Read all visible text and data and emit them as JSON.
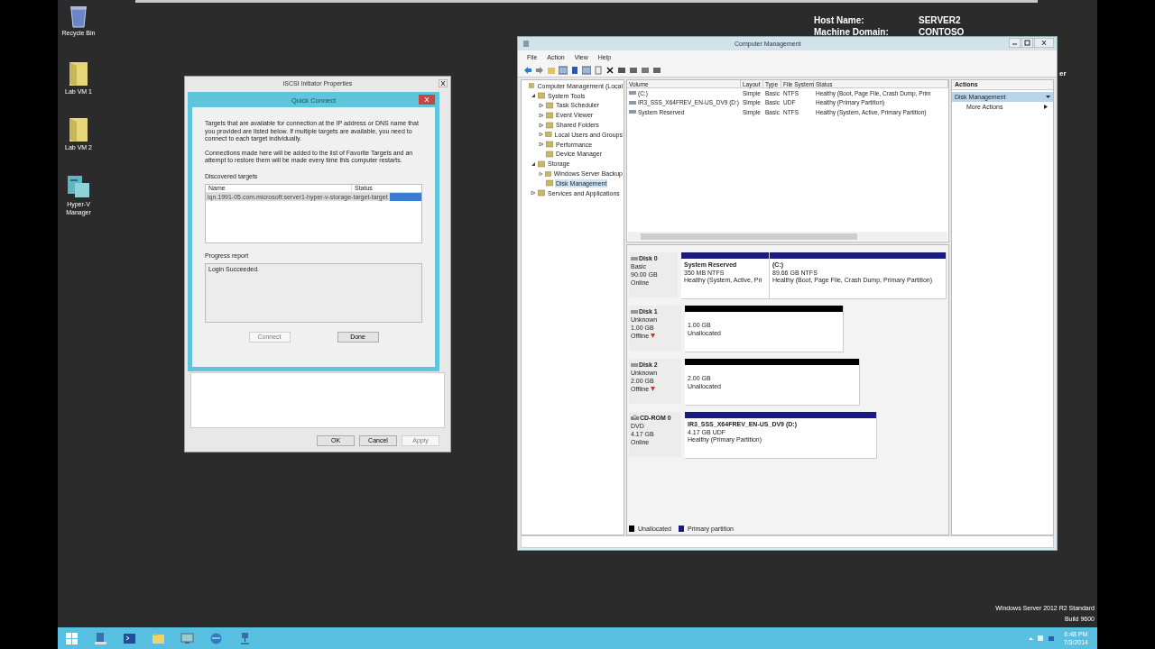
{
  "desktop_icons": [
    {
      "label": "Recycle Bin",
      "kind": "recycle"
    },
    {
      "label": "Lab VM 1",
      "kind": "folder"
    },
    {
      "label": "Lab VM 2",
      "kind": "folder"
    },
    {
      "label": "Hyper-V Manager",
      "kind": "hyperv"
    }
  ],
  "bginfo": [
    {
      "label": "Host Name:",
      "value": "SERVER2"
    },
    {
      "label": "Machine Domain:",
      "value": "CONTOSO"
    }
  ],
  "bginfo_fragment": "er",
  "os_edition": [
    "Windows Server 2012 R2 Standard",
    "Build 9600"
  ],
  "iscsi_window": {
    "title": "iSCSI Initiator Properties",
    "buttons": [
      {
        "label": "OK",
        "disabled": false
      },
      {
        "label": "Cancel",
        "disabled": false
      },
      {
        "label": "Apply",
        "disabled": true
      }
    ]
  },
  "quick_connect": {
    "title": "Quick Connect",
    "intro": "Targets that are available for connection at the IP address or DNS name that you provided are listed below.  If multiple targets are available, you need to connect to each target individually.",
    "note": "Connections made here will be added to the list of Favorite Targets and an attempt to restore them will be made every time this computer restarts.",
    "targets_label": "Discovered targets",
    "columns": [
      "Name",
      "Status"
    ],
    "targets": [
      {
        "name": "iqn.1991-05.com.microsoft:server1-hyper-v-storage-target-target",
        "selected": true
      }
    ],
    "progress_label": "Progress report",
    "progress": "Login Succeeded.",
    "buttons": [
      {
        "label": "Connect",
        "disabled": true
      },
      {
        "label": "Done",
        "disabled": false
      }
    ]
  },
  "computer_management": {
    "title": "Computer Management",
    "menu": [
      "File",
      "Action",
      "View",
      "Help"
    ],
    "tree": [
      {
        "label": "Computer Management (Local",
        "selected": false,
        "children": [
          {
            "label": "System Tools",
            "selected": false,
            "expanded": true,
            "children": [
              {
                "label": "Task Scheduler",
                "selected": false,
                "expanded": false
              },
              {
                "label": "Event Viewer",
                "selected": false,
                "expanded": false
              },
              {
                "label": "Shared Folders",
                "selected": false,
                "expanded": false
              },
              {
                "label": "Local Users and Groups",
                "selected": false,
                "expanded": false
              },
              {
                "label": "Performance",
                "selected": false,
                "expanded": false
              },
              {
                "label": "Device Manager",
                "selected": false
              }
            ]
          },
          {
            "label": "Storage",
            "selected": false,
            "expanded": true,
            "children": [
              {
                "label": "Windows Server Backup",
                "selected": false,
                "expanded": false
              },
              {
                "label": "Disk Management",
                "selected": true
              }
            ]
          },
          {
            "label": "Services and Applications",
            "selected": false,
            "expanded": false
          }
        ]
      }
    ],
    "volume_columns": [
      "Volume",
      "Layout",
      "Type",
      "File System",
      "Status"
    ],
    "volumes": [
      {
        "volume": "(C:)",
        "layout": "Simple",
        "type": "Basic",
        "file_system": "NTFS",
        "status": "Healthy (Boot, Page File, Crash Dump, Prim"
      },
      {
        "volume": "IR3_SSS_X64FREV_EN-US_DV9 (D:)",
        "layout": "Simple",
        "type": "Basic",
        "file_system": "UDF",
        "status": "Healthy (Primary Partition)"
      },
      {
        "volume": "System Reserved",
        "layout": "Simple",
        "type": "Basic",
        "file_system": "NTFS",
        "status": "Healthy (System, Active, Primary Partition)"
      }
    ],
    "disks": [
      {
        "name": "Disk 0",
        "kind": "disk",
        "offline": false,
        "info": [
          "Basic",
          "90.00 GB",
          "Online"
        ],
        "partitions": [
          {
            "kind": "primary",
            "name": "System Reserved",
            "size": "350 MB NTFS",
            "status": "Healthy (System, Active, Pri"
          },
          {
            "kind": "primary",
            "name": "(C:)",
            "size": "89.66 GB NTFS",
            "status": "Healthy (Boot, Page File, Crash Dump, Primary Partition)"
          }
        ]
      },
      {
        "name": "Disk 1",
        "kind": "disk",
        "offline": true,
        "info": [
          "Unknown",
          "1.00 GB",
          "Offline"
        ],
        "partitions": [
          {
            "kind": "unallocated",
            "size": "1.00 GB",
            "status": "Unallocated"
          }
        ]
      },
      {
        "name": "Disk 2",
        "kind": "disk",
        "offline": true,
        "info": [
          "Unknown",
          "2.00 GB",
          "Offline"
        ],
        "partitions": [
          {
            "kind": "unallocated",
            "size": "2.00 GB",
            "status": "Unallocated"
          }
        ]
      },
      {
        "name": "CD-ROM 0",
        "kind": "cdrom",
        "offline": false,
        "info": [
          "DVD",
          "4.17 GB",
          "Online"
        ],
        "partitions": [
          {
            "kind": "primary",
            "name": "IR3_SSS_X64FREV_EN-US_DV9 (D:)",
            "size": "4.17 GB UDF",
            "status": "Healthy (Primary Partition)"
          }
        ]
      }
    ],
    "legend": [
      {
        "label": "Unallocated",
        "color": "#000000"
      },
      {
        "label": "Primary partition",
        "color": "#1a1a80"
      }
    ],
    "actions": {
      "title": "Actions",
      "section": "Disk Management",
      "items": [
        "More Actions"
      ]
    }
  },
  "taskbar": {
    "time": "6:48 PM",
    "date": "7/3/2014"
  }
}
